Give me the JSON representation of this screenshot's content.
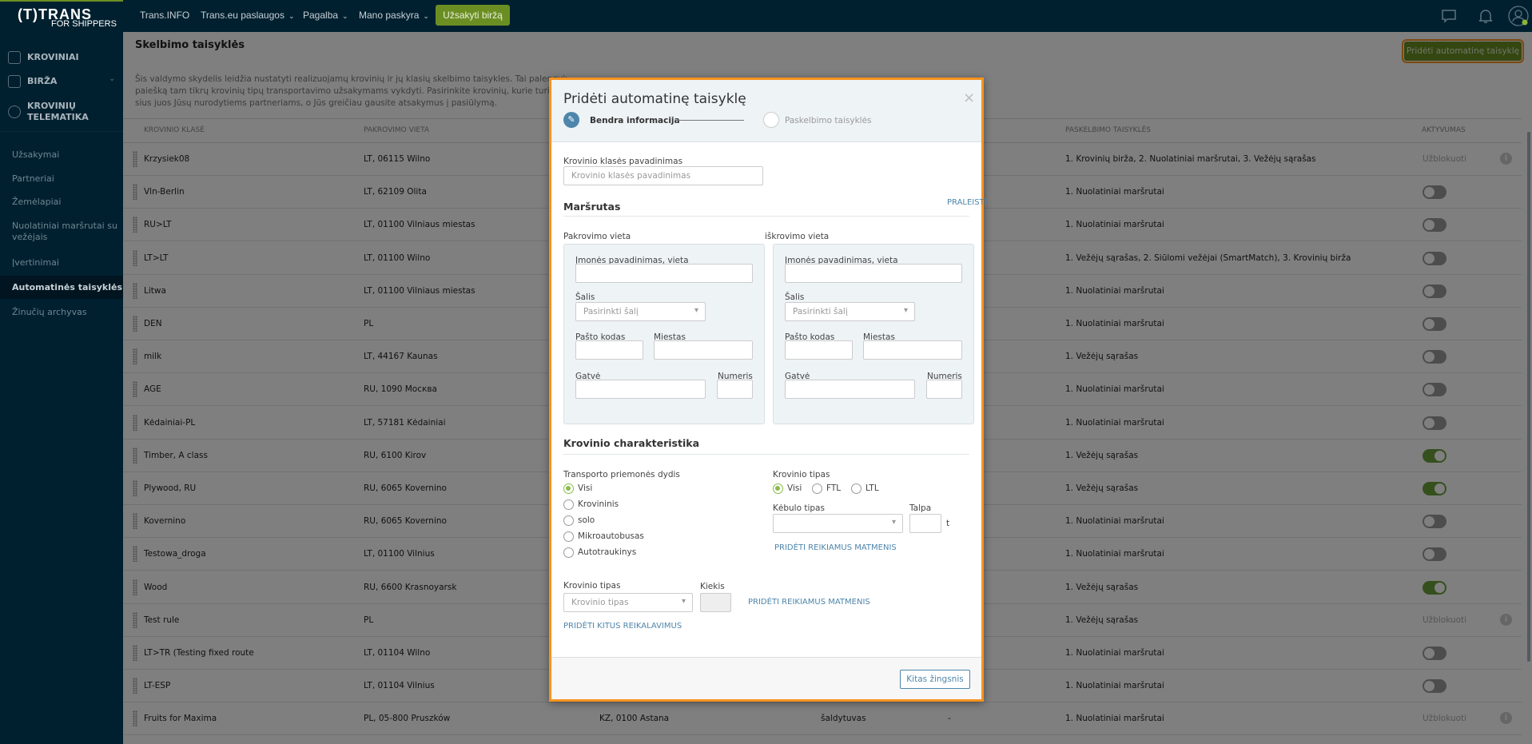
{
  "topbar": {
    "logo_main": "(T)TRANS",
    "logo_sub": "FOR SHIPPERS",
    "nav": [
      "Trans.INFO",
      "Trans.eu paslaugos",
      "Pagalba",
      "Mano paskyra"
    ],
    "order_button": "Užsakyti biržą"
  },
  "sidebar": {
    "top_items": [
      "KROVINIAI",
      "BIRŽA",
      "KROVINIŲ",
      "TELEMATIKA"
    ],
    "items": [
      "Užsakymai",
      "Partneriai",
      "Žemėlapiai",
      "Nuolatiniai maršrutai su",
      "vežėjais",
      "Įvertinimai",
      "Automatinės taisyklės",
      "Žinučių archyvas"
    ]
  },
  "page": {
    "title": "Skelbimo taisyklės",
    "description": [
      "Šis valdymo skydelis leidžia nustatyti realizuojamų krovinių ir jų klasių skelbimo taisykles. Tai palengvins valdymą. Skelbim",
      "paiešką tam tikrų krovinių tipų transportavimo užsakymams vykdyti. Pasirinkite krovinių, kurie turi būti perduodami šiai pa",
      "sius juos Jūsų nurodytiems partneriams, o Jūs greičiau gausite atsakymus į pasiūlymą."
    ],
    "add_rule_button": "Pridėti automatinę taisyklę"
  },
  "table": {
    "headers": [
      "Krovinio klasė",
      "Pakrovimo vieta",
      "Paskelbimo taisyklės",
      "Aktyvumas"
    ],
    "blocked_label": "Užblokuoti",
    "rows": [
      {
        "name": "Krzysiek08",
        "loading": "LT, 06115 Wilno",
        "rules": "1. Krovinių birža, 2. Nuolatiniai maršrutai, 3. Vežėjų sąrašas",
        "status": "blocked"
      },
      {
        "name": "Vln-Berlin",
        "loading": "LT, 62109 Olita",
        "rules": "1. Nuolatiniai maršrutai",
        "status": "off"
      },
      {
        "name": "RU>LT",
        "loading": "LT, 01100 Vilniaus miestas",
        "rules": "1. Nuolatiniai maršrutai",
        "status": "off"
      },
      {
        "name": "LT>LT",
        "loading": "LT, 01100 Wilno",
        "rules": "1. Vežėjų sąrašas, 2. Siūlomi vežėjai (SmartMatch), 3. Krovinių birža",
        "status": "off"
      },
      {
        "name": "Litwa",
        "loading": "LT, 01100 Vilniaus miestas",
        "rules": "1. Nuolatiniai maršrutai",
        "status": "off"
      },
      {
        "name": "DEN",
        "loading": "PL",
        "rules": "1. Nuolatiniai maršrutai",
        "status": "off"
      },
      {
        "name": "milk",
        "loading": "LT, 44167 Kaunas",
        "rules": "1. Vežėjų sąrašas",
        "status": "off"
      },
      {
        "name": "AGE",
        "loading": "RU, 1090 Москва",
        "rules": "1. Nuolatiniai maršrutai",
        "status": "off"
      },
      {
        "name": "Kėdainiai-PL",
        "loading": "LT, 57181 Kėdainiai",
        "rules": "1. Nuolatiniai maršrutai",
        "status": "off"
      },
      {
        "name": "Timber, A class",
        "loading": "RU, 6100 Kirov",
        "rules": "1. Vežėjų sąrašas",
        "status": "on"
      },
      {
        "name": "Plywood, RU",
        "loading": "RU, 6065 Kovernino",
        "rules": "1. Vežėjų sąrašas",
        "status": "on"
      },
      {
        "name": "Kovernino",
        "loading": "RU, 6065 Kovernino",
        "rules": "1. Nuolatiniai maršrutai",
        "status": "off"
      },
      {
        "name": "Testowa_droga",
        "loading": "LT, 01100 Vilnius",
        "rules": "1. Nuolatiniai maršrutai",
        "status": "off"
      },
      {
        "name": "Wood",
        "loading": "RU, 6600 Krasnoyarsk",
        "rules": "1. Vežėjų sąrašas",
        "status": "on"
      },
      {
        "name": "Test rule",
        "loading": "PL",
        "rules": "1. Vežėjų sąrašas",
        "status": "blocked"
      },
      {
        "name": "LT>TR (Testing fixed route",
        "loading": "LT, 01104 Wilno",
        "rules": "1. Nuolatiniai maršrutai",
        "status": "off"
      },
      {
        "name": "LT-ESP",
        "loading": "LT, 01104 Vilnius",
        "rules": "1. Nuolatiniai maršrutai",
        "status": "off"
      },
      {
        "name": "Fruits for Maxima",
        "loading": "PL, 05-800 Pruszków",
        "unloading": "KZ, 0100 Astana",
        "body": "šaldytuvas",
        "extra": "-",
        "rules": "1. Nuolatiniai maršrutai",
        "status": "blocked"
      }
    ]
  },
  "modal": {
    "title": "Pridėti automatinę taisyklę",
    "close": "×",
    "steps": [
      "Bendra informacija",
      "Paskelbimo taisyklės"
    ],
    "class_name_label": "Krovinio klasės pavadinimas",
    "class_name_placeholder": "Krovinio klasės pavadinimas",
    "route_title": "Maršrutas",
    "skip": "PRALEISTI",
    "loading_label": "Pakrovimo vieta",
    "unloading_label": "iškrovimo vieta",
    "company_label": "Įmonės pavadinimas, vieta",
    "country_label": "Šalis",
    "country_placeholder": "Pasirinkti šalį",
    "postcode_label": "Pašto kodas",
    "city_label": "Miestas",
    "street_label": "Gatvė",
    "number_label": "Numeris",
    "cargo_title": "Krovinio charakteristika",
    "vehicle_size_label": "Transporto priemonės dydis",
    "vehicle_sizes": [
      "Visi",
      "Krovininis",
      "solo",
      "Mikroautobusas",
      "Autotraukinys"
    ],
    "cargo_type_label": "Krovinio tipas",
    "cargo_types": [
      "Visi",
      "FTL",
      "LTL"
    ],
    "body_type_label": "Kėbulo tipas",
    "capacity_label": "Talpa",
    "capacity_unit": "t",
    "add_dimensions": "PRIDĖTI REIKIAMUS MATMENIS",
    "cargo_kind_label": "Krovinio tipas",
    "cargo_kind_placeholder": "Krovinio tipas",
    "quantity_label": "Kiekis",
    "add_other": "PRIDĖTI KITUS REIKALAVIMUS",
    "next": "Kitas žingsnis"
  }
}
